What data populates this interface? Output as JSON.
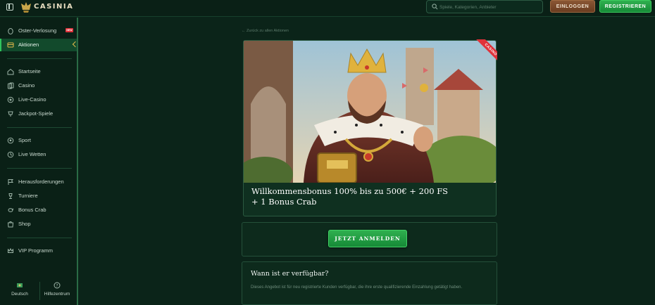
{
  "header": {
    "logo_text": "CASINIA",
    "search_placeholder": "Spiele, Kategorien, Anbieter",
    "login_label": "EINLOGGEN",
    "register_label": "REGISTRIEREN"
  },
  "sidebar": {
    "items": [
      {
        "label": "Oster-Verlosung",
        "icon": "egg-icon",
        "badge": "NEW"
      },
      {
        "label": "Aktionen",
        "icon": "promotions-icon"
      },
      {
        "label": "Startseite",
        "icon": "home-icon"
      },
      {
        "label": "Casino",
        "icon": "cards-icon"
      },
      {
        "label": "Live-Casino",
        "icon": "live-icon"
      },
      {
        "label": "Jackpot-Spiele",
        "icon": "jackpot-icon"
      },
      {
        "label": "Sport",
        "icon": "ball-icon"
      },
      {
        "label": "Live Wetten",
        "icon": "live-bet-icon"
      },
      {
        "label": "Herausforderungen",
        "icon": "challenge-icon"
      },
      {
        "label": "Turniere",
        "icon": "trophy-icon"
      },
      {
        "label": "Bonus Crab",
        "icon": "crab-icon"
      },
      {
        "label": "Shop",
        "icon": "shop-icon"
      },
      {
        "label": "VIP Programm",
        "icon": "crown-icon"
      }
    ],
    "footer": {
      "language_label": "Deutsch",
      "help_label": "Hilfezentrum"
    }
  },
  "main": {
    "back_link": "Zurück zu allen Aktionen",
    "promo": {
      "ribbon": "CASINO",
      "title_line1": "Willkommensbonus 100% bis zu 500€ + 200 FS",
      "title_line2": "+ 1 Bonus Crab"
    },
    "cta_label": "JETZT ANMELDEN",
    "availability": {
      "title": "Wann ist er verfügbar?",
      "text": "Dieses Angebot ist für neu registrierte Kunden verfügbar, die ihre erste qualifizierende Einzahlung getätigt haben."
    }
  },
  "colors": {
    "accent_green": "#2fb04f",
    "login_brown": "#8a5634",
    "background": "#0b2419",
    "ribbon_red": "#e0323a"
  }
}
